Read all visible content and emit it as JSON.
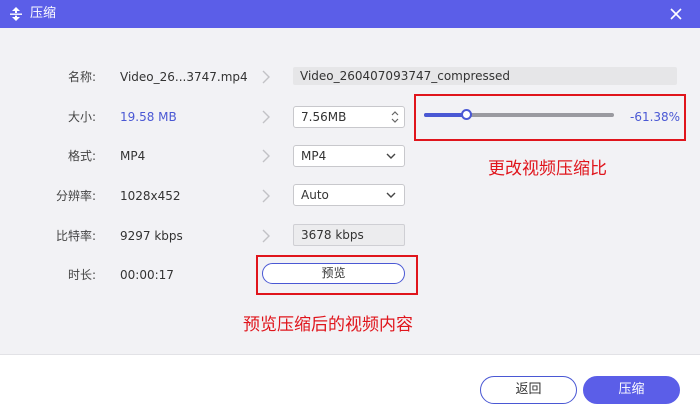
{
  "titlebar": {
    "title": "压缩",
    "app_icon": "compress-icon",
    "close_icon": "close-icon"
  },
  "rows": {
    "name": {
      "label": "名称:",
      "source": "Video_26...3747.mp4",
      "output": "Video_260407093747_compressed"
    },
    "size": {
      "label": "大小:",
      "source": "19.58 MB",
      "output": "7.56MB",
      "slider_fraction": 0.225,
      "percent": "-61.38%"
    },
    "format": {
      "label": "格式:",
      "source": "MP4",
      "output": "MP4"
    },
    "resolution": {
      "label": "分辨率:",
      "source": "1028x452",
      "output": "Auto"
    },
    "bitrate": {
      "label": "比特率:",
      "source": "9297 kbps",
      "output": "3678 kbps"
    },
    "duration": {
      "label": "时长:",
      "source": "00:00:17"
    }
  },
  "preview_button": "预览",
  "annotations": {
    "slider_note": "更改视频压缩比",
    "preview_note": "预览压缩后的视频内容"
  },
  "footer": {
    "back_label": "返回",
    "compress_label": "压缩"
  },
  "colors": {
    "accent": "#5b5ee8",
    "link_blue": "#4a58d4",
    "annotation_red": "#e0151c"
  }
}
